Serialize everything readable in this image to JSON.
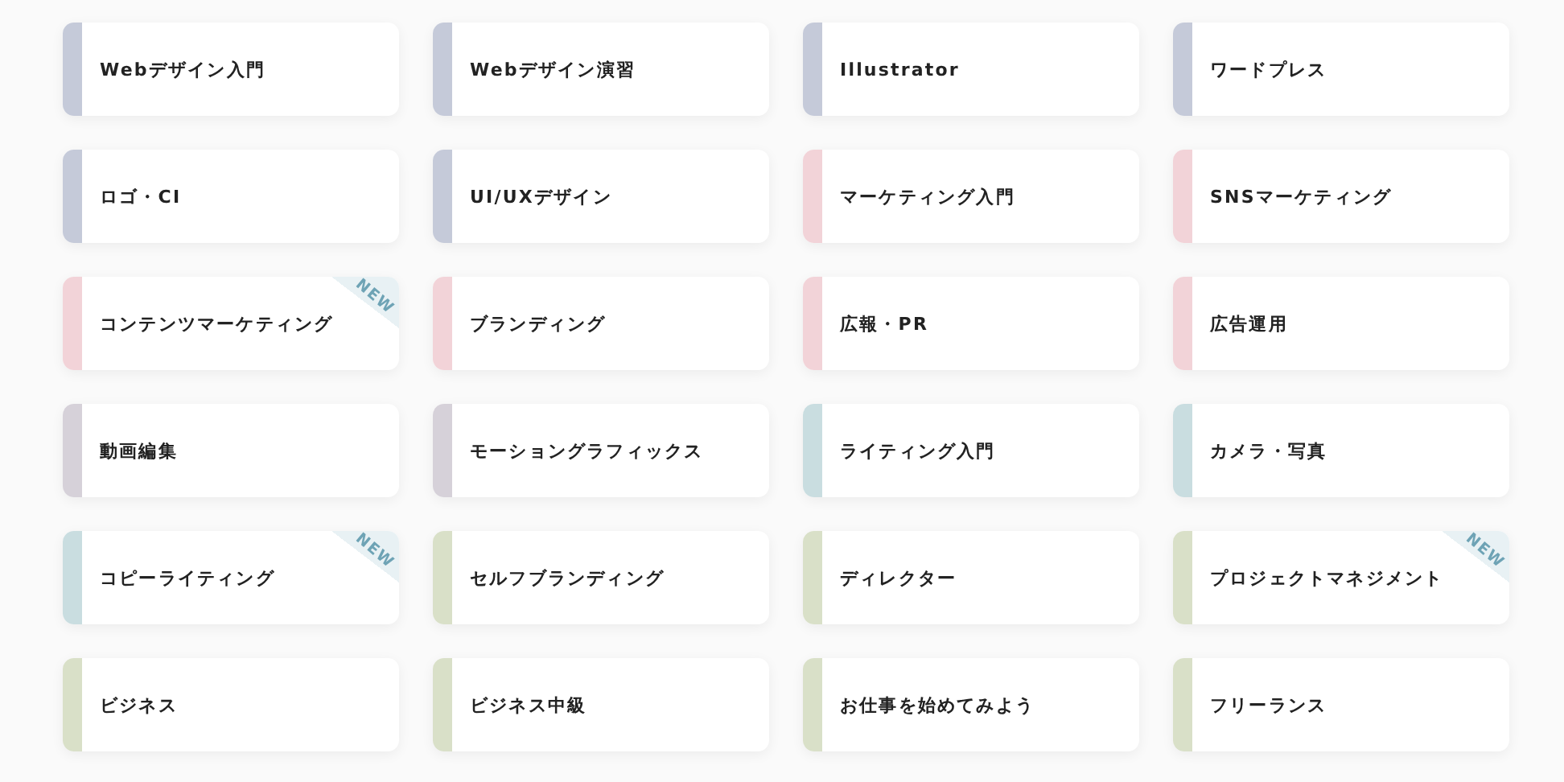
{
  "courses": [
    {
      "label": "Webデザイン入門",
      "color": "#c5cad9",
      "new": false
    },
    {
      "label": "Webデザイン演習",
      "color": "#c5cad9",
      "new": false
    },
    {
      "label": "Illustrator",
      "color": "#c5cad9",
      "new": false
    },
    {
      "label": "ワードプレス",
      "color": "#c5cad9",
      "new": false
    },
    {
      "label": "ロゴ・CI",
      "color": "#c5cad9",
      "new": false
    },
    {
      "label": "UI/UXデザイン",
      "color": "#c5cad9",
      "new": false
    },
    {
      "label": "マーケティング入門",
      "color": "#f2d3d8",
      "new": false
    },
    {
      "label": "SNSマーケティング",
      "color": "#f2d3d8",
      "new": false
    },
    {
      "label": "コンテンツマーケティング",
      "color": "#f2d3d8",
      "new": true,
      "badge": "NEW"
    },
    {
      "label": "ブランディング",
      "color": "#f2d3d8",
      "new": false
    },
    {
      "label": "広報・PR",
      "color": "#f2d3d8",
      "new": false
    },
    {
      "label": "広告運用",
      "color": "#f2d3d8",
      "new": false
    },
    {
      "label": "動画編集",
      "color": "#d6d1d9",
      "new": false
    },
    {
      "label": "モーショングラフィックス",
      "color": "#d6d1d9",
      "new": false
    },
    {
      "label": "ライティング入門",
      "color": "#c9dde0",
      "new": false
    },
    {
      "label": "カメラ・写真",
      "color": "#c9dde0",
      "new": false
    },
    {
      "label": "コピーライティング",
      "color": "#c9dde0",
      "new": true,
      "badge": "NEW"
    },
    {
      "label": "セルフブランディング",
      "color": "#d9e0c8",
      "new": false
    },
    {
      "label": "ディレクター",
      "color": "#d9e0c8",
      "new": false
    },
    {
      "label": "プロジェクトマネジメント",
      "color": "#d9e0c8",
      "new": true,
      "badge": "NEW"
    },
    {
      "label": "ビジネス",
      "color": "#d9e0c8",
      "new": false
    },
    {
      "label": "ビジネス中級",
      "color": "#d9e0c8",
      "new": false
    },
    {
      "label": "お仕事を始めてみよう",
      "color": "#d9e0c8",
      "new": false
    },
    {
      "label": "フリーランス",
      "color": "#d9e0c8",
      "new": false
    }
  ]
}
